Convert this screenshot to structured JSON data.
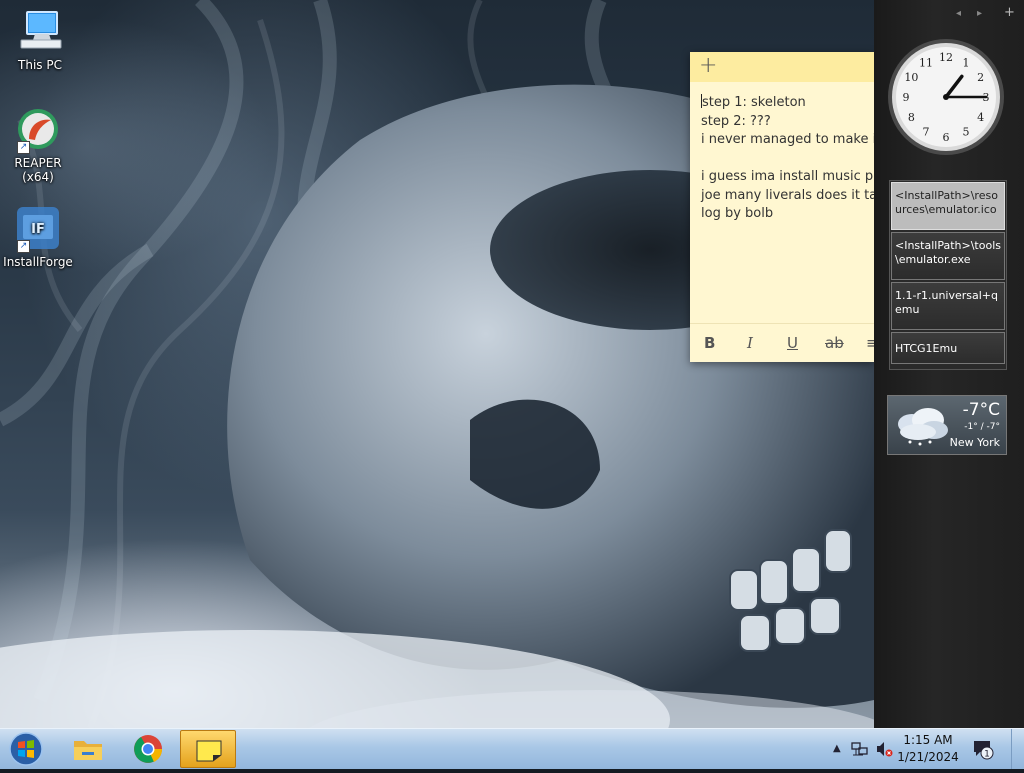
{
  "desktop": {
    "icons": [
      {
        "label": "This PC",
        "icon": "computer-icon"
      },
      {
        "label": "REAPER (x64)",
        "icon": "reaper-icon"
      },
      {
        "label": "InstallForge",
        "icon": "installforge-icon"
      }
    ]
  },
  "sticky_note": {
    "new_note_label": "+",
    "lines": [
      "step 1: skeleton",
      "step 2: ???",
      "i never managed to make it",
      "",
      "i guess ima install music pro",
      "joe many liverals does it tak",
      "log by bolb"
    ],
    "toolbar": {
      "bold": "B",
      "italic": "I",
      "underline": "U",
      "strikethrough": "ab",
      "bullets": "≡"
    }
  },
  "sidebar": {
    "controls": {
      "prev": "◂",
      "next": "▸",
      "add": "+"
    },
    "clock": {
      "hour": 1,
      "minute": 15
    },
    "slideshow_items": [
      "<InstallPath>\\resources\\emulator.ico",
      "<InstallPath>\\tools\\emulator.exe",
      "1.1-r1.universal+qemu",
      "HTCG1Emu"
    ],
    "weather": {
      "temperature": "-7°C",
      "range": "-1° / -7°",
      "city": "New York"
    }
  },
  "taskbar": {
    "apps": [
      {
        "name": "file-explorer",
        "icon": "folder-icon"
      },
      {
        "name": "chrome",
        "icon": "chrome-icon"
      },
      {
        "name": "sticky-notes",
        "icon": "sticky-notes-icon",
        "active": true
      }
    ],
    "tray": {
      "show_hidden": "▲",
      "time": "1:15 AM",
      "date": "1/21/2024",
      "notification_count": "1"
    }
  }
}
